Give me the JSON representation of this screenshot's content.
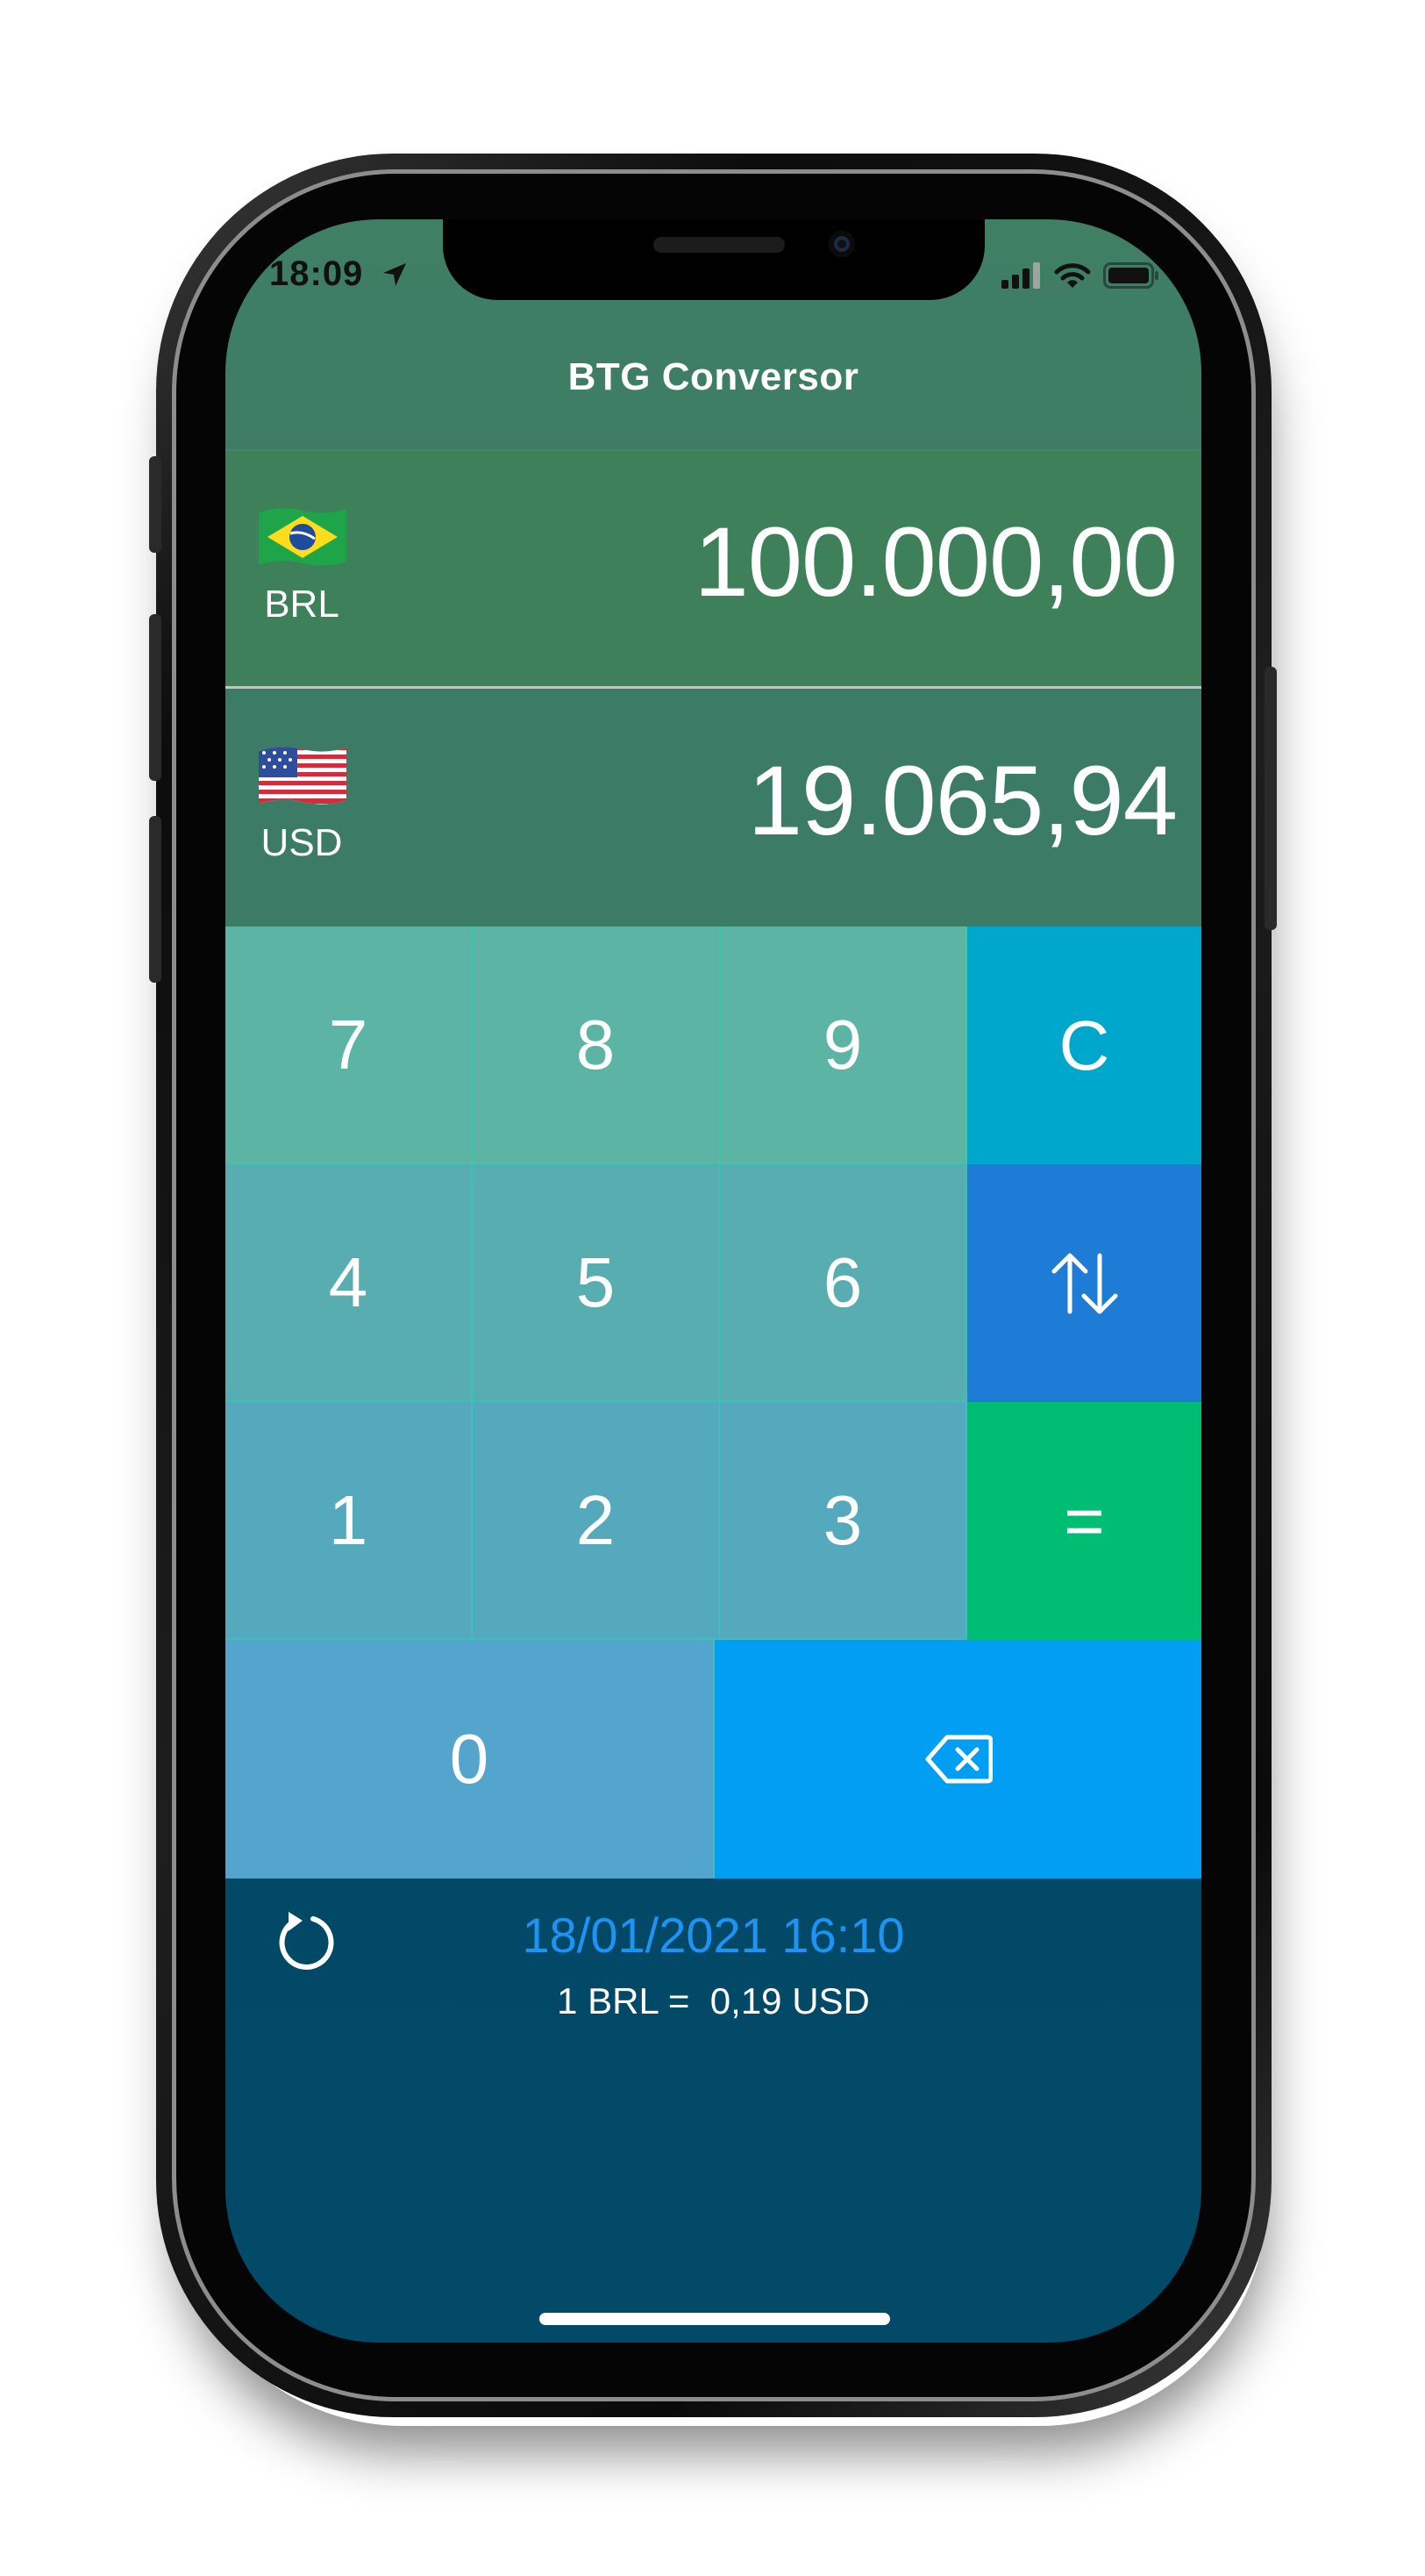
{
  "status_bar": {
    "time": "18:09",
    "location_icon": "location-arrow-icon",
    "signal_icon": "cellular-signal-icon",
    "wifi_icon": "wifi-icon",
    "battery_icon": "battery-icon"
  },
  "nav": {
    "title": "BTG Conversor"
  },
  "currencies": [
    {
      "code": "BRL",
      "amount": "100.000,00",
      "flag": "brazil-flag"
    },
    {
      "code": "USD",
      "amount": "19.065,94",
      "flag": "usa-flag"
    }
  ],
  "keypad": {
    "k7": "7",
    "k8": "8",
    "k9": "9",
    "clear": "C",
    "k4": "4",
    "k5": "5",
    "k6": "6",
    "swap_icon": "swap-arrows-icon",
    "k1": "1",
    "k2": "2",
    "k3": "3",
    "equals": "=",
    "k0": "0",
    "backspace_icon": "backspace-icon"
  },
  "info": {
    "updated": "18/01/2021 16:10",
    "rate": "1 BRL =  0,19 USD",
    "refresh_icon": "refresh-icon"
  },
  "colors": {
    "header": "#3f7f64",
    "brl_row": "#3e8059",
    "usd_row": "#3c7b66",
    "digit_top": "#5bb4a4",
    "digit_bottom": "#53a5cd",
    "clear_key": "#00a7cc",
    "swap_key": "#1e7bd6",
    "equals_key": "#00bd74",
    "backspace_key": "#029ef3",
    "footer": "#024a68",
    "date_text": "#1d93f3"
  }
}
